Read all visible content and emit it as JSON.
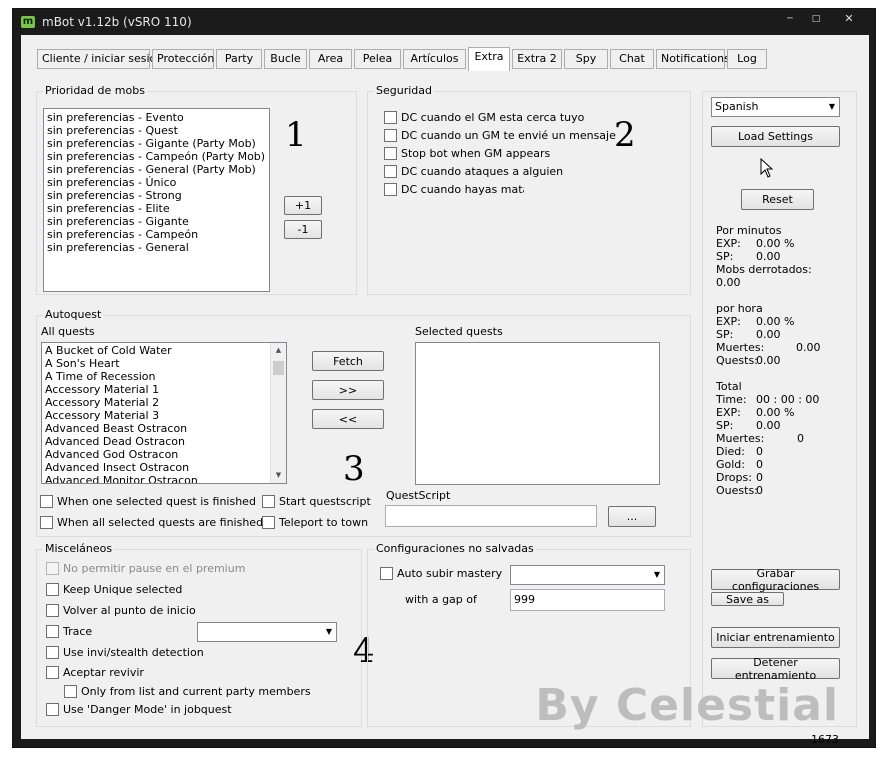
{
  "window": {
    "title": "mBot v1.12b (vSRO 110)",
    "app_icon": "m",
    "status_number": "1673"
  },
  "tabs": [
    {
      "label": "Cliente / iniciar sesión"
    },
    {
      "label": "Protección"
    },
    {
      "label": "Party"
    },
    {
      "label": "Bucle"
    },
    {
      "label": "Area"
    },
    {
      "label": "Pelea"
    },
    {
      "label": "Artículos"
    },
    {
      "label": "Extra",
      "active": true
    },
    {
      "label": "Extra 2"
    },
    {
      "label": "Spy"
    },
    {
      "label": "Chat"
    },
    {
      "label": "Notifications"
    },
    {
      "label": "Log"
    }
  ],
  "mobs": {
    "title": "Prioridad de mobs",
    "items": [
      "sin preferencias - Evento",
      "sin preferencias - Quest",
      "sin preferencias - Gigante (Party Mob)",
      "sin preferencias - Campeón (Party Mob)",
      "sin preferencias - General (Party Mob)",
      "sin preferencias - Único",
      "sin preferencias - Strong",
      "sin preferencias - Elite",
      "sin preferencias - Gigante",
      "sin preferencias - Campeón",
      "sin preferencias - General"
    ],
    "plus_label": "+1",
    "minus_label": "-1",
    "annotation": "1"
  },
  "security": {
    "title": "Seguridad",
    "options": [
      "DC cuando el GM esta cerca tuyo",
      "DC cuando un GM te envié un mensaje",
      "Stop bot when GM appears",
      "DC cuando ataques a alguien",
      "DC cuando hayas matado"
    ],
    "annotation": "2"
  },
  "autoquest": {
    "title": "Autoquest",
    "all_label": "All quests",
    "selected_label": "Selected quests",
    "quests": [
      "A Bucket of Cold Water",
      "A Son's Heart",
      "A Time of Recession",
      "Accessory Material 1",
      "Accessory Material 2",
      "Accessory Material 3",
      "Advanced Beast Ostracon",
      "Advanced Dead Ostracon",
      "Advanced God Ostracon",
      "Advanced Insect Ostracon",
      "Advanced Monitor Ostracon"
    ],
    "fetch_label": "Fetch",
    "add_label": ">>",
    "remove_label": "<<",
    "opt_one_finished": "When one selected quest is finished",
    "opt_all_finished": "When all selected quests are finished",
    "opt_start_script": "Start questscript",
    "opt_teleport": "Teleport to town",
    "questscript_label": "QuestScript",
    "questscript_value": "",
    "browse_label": "...",
    "annotation": "3"
  },
  "misc": {
    "title": "Misceláneos",
    "no_pause": "No permitir pause en el premium",
    "keep_unique": "Keep Unique selected",
    "return_point": "Volver al punto de inicio",
    "trace": "Trace",
    "trace_value": "",
    "invi_detect": "Use invi/stealth detection",
    "accept_revive": "Aceptar revivir",
    "only_from_list": "Only from list and current party members",
    "danger_mode": "Use 'Danger Mode' in jobquest",
    "annotation": "4"
  },
  "unsaved": {
    "title": "Configuraciones no salvadas",
    "auto_mastery": "Auto subir mastery",
    "mastery_value": "",
    "gap_label": "with a gap of",
    "gap_value": "999"
  },
  "right": {
    "language": "Spanish",
    "load_settings": "Load Settings",
    "reset": "Reset",
    "per_minute_title": "Por minutos",
    "exp_label": "EXP:",
    "sp_label": "SP:",
    "pm_exp": "0.00 %",
    "pm_sp": "0.00",
    "mobs_killed_label": "Mobs derrotados:",
    "mobs_killed": "0.00",
    "per_hour_title": "por hora",
    "ph_exp": "0.00 %",
    "ph_sp": "0.00",
    "deaths_label": "Muertes:",
    "ph_deaths": "0.00",
    "quests_label": "Quests:",
    "ph_quests": "0.00",
    "total_title": "Total",
    "time_label": "Time:",
    "total_time": "00 : 00 : 00",
    "total_exp": "0.00 %",
    "total_sp": "0.00",
    "total_deaths": "0",
    "died_label": "Died:",
    "died": "0",
    "gold_label": "Gold:",
    "gold": "0",
    "drops_label": "Drops:",
    "drops": "0",
    "ouests_label": "Ouests:",
    "ouests": "0",
    "save_config": "Grabar configuraciones",
    "save_as": "Save as",
    "start_training": "Iniciar entrenamiento",
    "stop_training": "Detener entrenamiento"
  },
  "watermark": "By Celestial"
}
